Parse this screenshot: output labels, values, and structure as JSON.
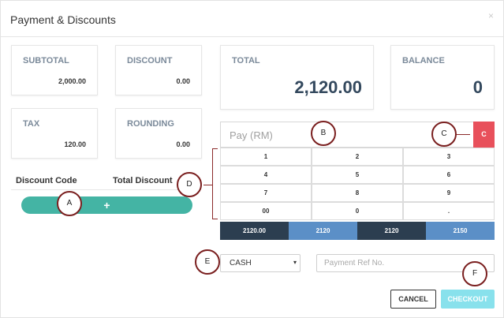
{
  "dialog": {
    "title": "Payment & Discounts",
    "close_glyph": "×"
  },
  "summary": {
    "subtotal": {
      "label": "SUBTOTAL",
      "value": "2,000.00"
    },
    "discount": {
      "label": "DISCOUNT",
      "value": "0.00"
    },
    "tax": {
      "label": "TAX",
      "value": "120.00"
    },
    "rounding": {
      "label": "ROUNDING",
      "value": "0.00"
    },
    "total": {
      "label": "TOTAL",
      "value": "2,120.00"
    },
    "balance": {
      "label": "BALANCE",
      "value": "0"
    }
  },
  "discounts": {
    "code_header": "Discount Code",
    "total_header": "Total Discount",
    "add_glyph": "+"
  },
  "pay": {
    "placeholder": "Pay (RM)",
    "clear_label": "C"
  },
  "keypad": [
    "1",
    "2",
    "3",
    "4",
    "5",
    "6",
    "7",
    "8",
    "9",
    "00",
    "0",
    "."
  ],
  "quick_amounts": [
    {
      "label": "2120.00",
      "color": "#2c3e50"
    },
    {
      "label": "2120",
      "color": "#5b8fc7"
    },
    {
      "label": "2120",
      "color": "#2c3e50"
    },
    {
      "label": "2150",
      "color": "#5b8fc7"
    }
  ],
  "payment_method": {
    "selected": "CASH",
    "caret": "▾"
  },
  "payment_ref": {
    "placeholder": "Payment Ref No."
  },
  "actions": {
    "cancel": "CANCEL",
    "checkout": "CHECKOUT"
  },
  "annotations": [
    "A",
    "B",
    "C",
    "D",
    "E",
    "F"
  ],
  "colors": {
    "accent_teal": "#44b4a4",
    "danger": "#e8505b",
    "checkout": "#88e1ec",
    "annotation": "#7a1f1f"
  }
}
